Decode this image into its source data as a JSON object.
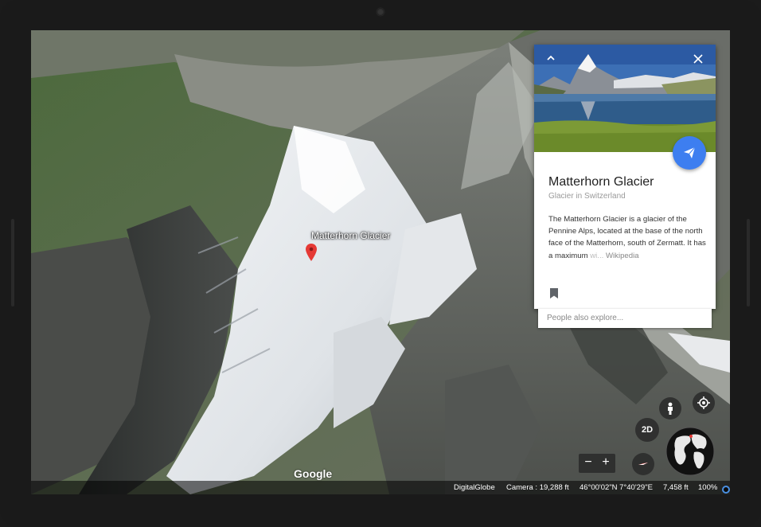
{
  "map": {
    "place_label": "Matterhorn Glacier",
    "watermark": "Google"
  },
  "info_card": {
    "title": "Matterhorn Glacier",
    "subtitle": "Glacier in Switzerland",
    "description": "The Matterhorn Glacier is a glacier of the Pennine Alps, located at the base of the north face of the Matterhorn, south of Zermatt. It has a maximum",
    "description_fade": "wi...",
    "source": "Wikipedia",
    "collapse_icon": "chevron-up-icon",
    "close_icon": "close-icon",
    "share_icon": "paper-plane-icon",
    "bookmark_icon": "bookmark-icon"
  },
  "people_also_explore": {
    "placeholder": "People also explore..."
  },
  "controls": {
    "view_mode": "2D",
    "zoom_out": "−",
    "zoom_in": "+",
    "pegman_icon": "pegman-icon",
    "locate_icon": "my-location-icon",
    "compass_icon": "compass-icon",
    "globe_icon": "globe-icon"
  },
  "status_bar": {
    "imagery": "DigitalGlobe",
    "camera": "Camera : 19,288 ft",
    "coordinates": "46°00'02\"N 7°40'29\"E",
    "elevation": "7,458 ft",
    "zoom": "100%"
  },
  "colors": {
    "accent_blue": "#3d7ef0",
    "pin_red": "#e53935"
  }
}
